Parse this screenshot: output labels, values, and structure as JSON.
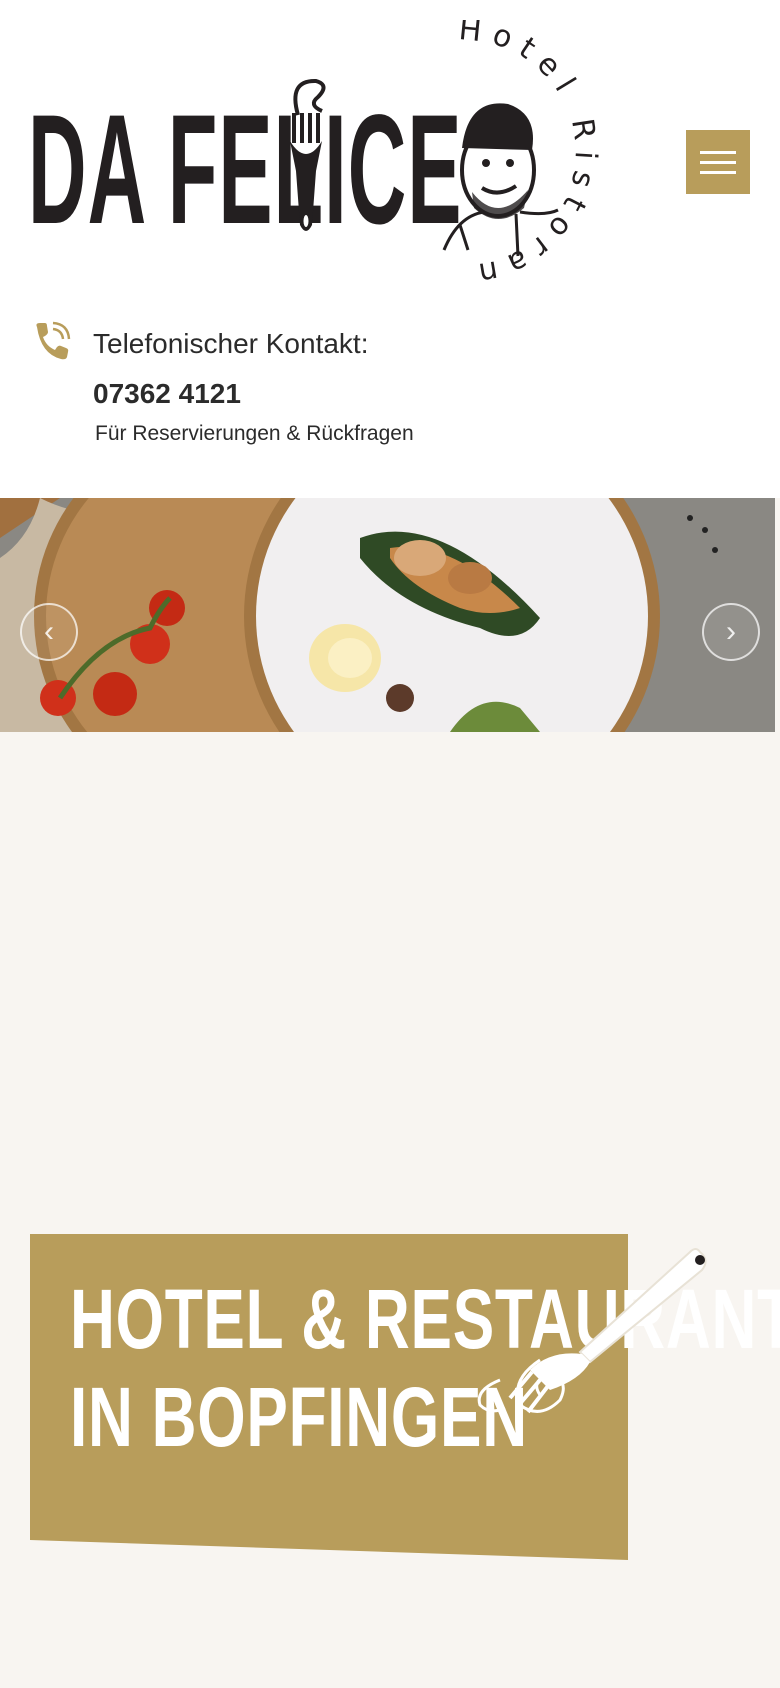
{
  "header": {
    "logo": {
      "brand": "DA FELICE",
      "arc_text": "Hotel Ristorante"
    },
    "menu_icon": "hamburger-menu-icon"
  },
  "contact": {
    "icon": "phone-icon",
    "label": "Telefonischer Kontakt:",
    "number": "07362 4121",
    "subtitle": "Für Reservierungen & Rückfragen"
  },
  "slider": {
    "prev_icon": "chevron-left-icon",
    "next_icon": "chevron-right-icon",
    "prev_glyph": "‹",
    "next_glyph": "›"
  },
  "hero": {
    "title_line1": "HOTEL & RESTAURANT",
    "title_line2": "IN BOPFINGEN"
  },
  "colors": {
    "accent": "#b89d5b",
    "background": "#f8f5f1",
    "text": "#2b2b2b"
  }
}
